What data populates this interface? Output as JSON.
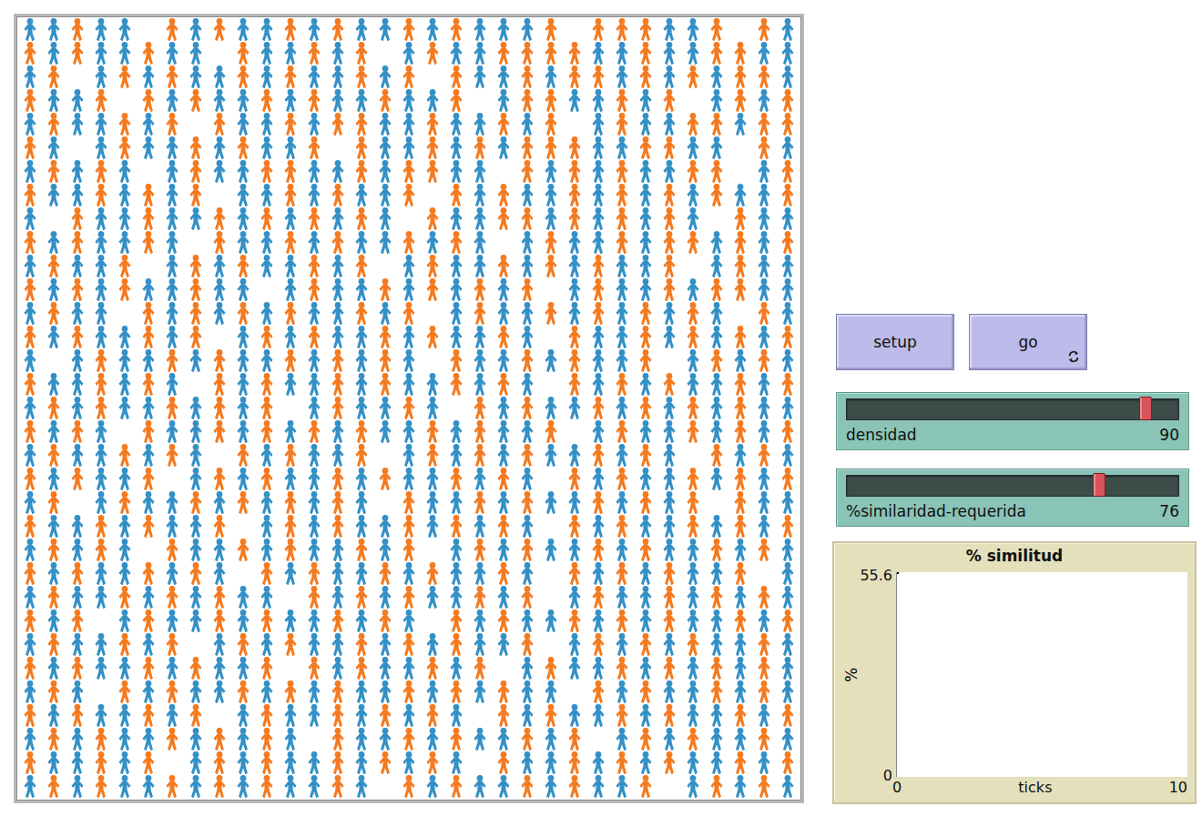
{
  "world": {
    "agent_colors": {
      "o": "#f47a1f",
      "b": "#3390c6"
    },
    "rows": [
      "bbobb.obobbobobbobobbbo.ooobbo.ob",
      "obobbobb.obbobo.bobboooobbobboobb",
      "bo.bobobbobobbobo.obbobooboboboob",
      "obbo.obobbobobbobbo.boobbobo.bobo",
      "bobbobo.obboboobbobbobo.bobbooboo",
      "ob.bobbobobbo.obbobobooobboobb.obb",
      "bobob.bobboobboboobb.obobobboo.bo",
      "obbobobo.bbobobbo.obobbobobobobbo",
      "b.obbobbobobobob.obboobobobob.obb",
      "obobbob.obbobobbobob.bobboboobobo",
      "bobbo.bobobbobo.bobbobobobbo.bobb",
      "obobobbobb.bobbobobobo.bobboboobb",
      "bobb.obobobobbobo.bobbobobobob.ob",
      "obobbobo.bobobbobobbob.obbobobobo",
      "b.bobbobobbobobob.obbobobbo.bobob",
      "obbobob.obobbobobbobob.obobobbobo",
      "bobobbobobo.bobbob.obobbobobobobb",
      "obob.obbobobobobbobobbo.bobbobobo",
      "bobbobob.obobbo.bobobobbobob.obob",
      "obobbo.bobobbobobbobob.obobbobobo",
      "bo.bobbobobobob.obbobobbobobo.obb",
      "obbobobbo.bobobbobobob.obobbobobo",
      "bobob.obbobobbobo.bobobbobobbobob",
      "obobbobob.obobbobobbob.obobobbo.b",
      "bobbobobobb.obobobbobo.bobbobobob",
      "obo.bobbobobbobob.obobbobobobbobo",
      "bobbobo.bobobbobobobbo.bobobobbob",
      "obobbobobbo.obobbobo.bobbobobobob",
      "bob.obobbobobobbobobobb.obobbobob",
      "obobbobo.bobbobobob.obobbobobbobo",
      "bobobbobobob.obbobobbobo.bobobbob",
      "obbobo.bobobbobobob.obbobobobbobo",
      "bobobbobobobbob.obobbobobbo.bobob"
    ]
  },
  "buttons": [
    {
      "label": "setup",
      "forever": false
    },
    {
      "label": "go",
      "forever": true
    }
  ],
  "sliders": [
    {
      "label": "densidad",
      "value": "90",
      "level": 0.9
    },
    {
      "label": "%similaridad-requerida",
      "value": "76",
      "level": 0.76
    }
  ],
  "plot": {
    "title": "% similitud",
    "y_label": "%",
    "y_max": "55.6",
    "y_min": "0",
    "x_label": "ticks",
    "x_min": "0",
    "x_max": "10",
    "series": [
      {
        "values": [
          55.6
        ],
        "color": "#000000"
      }
    ]
  }
}
